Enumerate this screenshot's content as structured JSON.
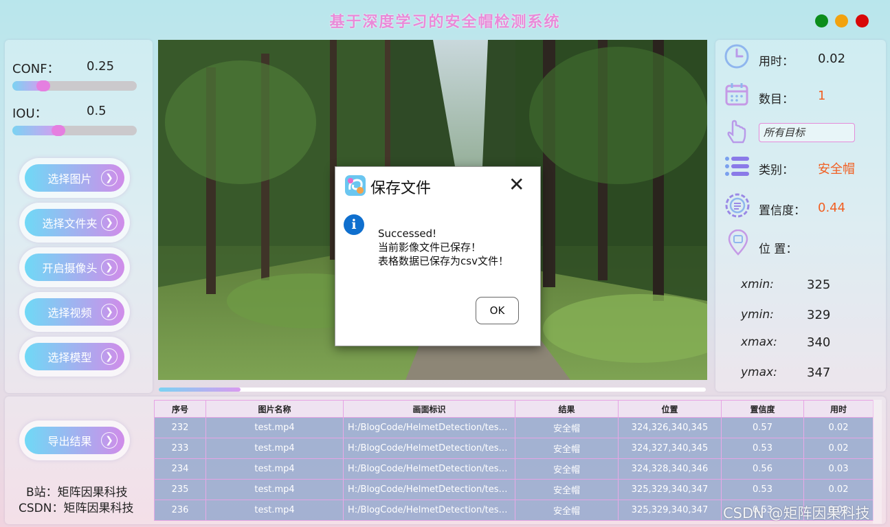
{
  "title": "基于深度学习的安全帽检测系统",
  "colors": {
    "accent": "#e98ad8",
    "orange": "#f15f22",
    "win_green": "#0c8d1c",
    "win_yellow": "#f2a20f",
    "win_red": "#d80808"
  },
  "params": {
    "conf_label": "CONF：",
    "conf_value": "0.25",
    "conf_fraction": 0.25,
    "iou_label": "IOU：",
    "iou_value": "0.5",
    "iou_fraction": 0.5
  },
  "buttons": {
    "select_image": "选择图片",
    "select_folder": "选择文件夹",
    "open_camera": "开启摄像头",
    "select_video": "选择视频",
    "select_model": "选择模型",
    "export": "导出结果"
  },
  "video": {
    "progress_fraction": 0.15
  },
  "dialog": {
    "title": "保存文件",
    "close": "✕",
    "info_icon": "i",
    "line1": "Successed!",
    "line2": "当前影像文件已保存！",
    "line3": "表格数据已保存为csv文件！",
    "ok": "OK"
  },
  "stats": {
    "time_label": "用时：",
    "time_value": "0.02",
    "count_label": "数目：",
    "count_value": "1",
    "target_select": "所有目标",
    "class_label": "类别：",
    "class_value": "安全帽",
    "conf_label": "置信度：",
    "conf_value": "0.44",
    "pos_label": "位 置：",
    "xmin_label": "xmin:",
    "xmin": "325",
    "ymin_label": "ymin:",
    "ymin": "329",
    "xmax_label": "xmax:",
    "xmax": "340",
    "ymax_label": "ymax:",
    "ymax": "347"
  },
  "credits": {
    "bilibili": "B站：矩阵因果科技",
    "csdn": "CSDN：矩阵因果科技"
  },
  "table": {
    "headers": [
      "序号",
      "图片名称",
      "画面标识",
      "结果",
      "位置",
      "置信度",
      "用时"
    ],
    "rows": [
      [
        "232",
        "test.mp4",
        "H:/BlogCode/HelmetDetection/test_...",
        "安全帽",
        "324,326,340,345",
        "0.57",
        "0.02"
      ],
      [
        "233",
        "test.mp4",
        "H:/BlogCode/HelmetDetection/test_...",
        "安全帽",
        "324,327,340,345",
        "0.53",
        "0.02"
      ],
      [
        "234",
        "test.mp4",
        "H:/BlogCode/HelmetDetection/test_...",
        "安全帽",
        "324,328,340,346",
        "0.56",
        "0.03"
      ],
      [
        "235",
        "test.mp4",
        "H:/BlogCode/HelmetDetection/test_...",
        "安全帽",
        "325,329,340,347",
        "0.53",
        "0.02"
      ],
      [
        "236",
        "test.mp4",
        "H:/BlogCode/HelmetDetection/test_...",
        "安全帽",
        "325,329,340,347",
        "0.53",
        "0.02"
      ]
    ]
  },
  "watermark": "CSDN @矩阵因果科技"
}
